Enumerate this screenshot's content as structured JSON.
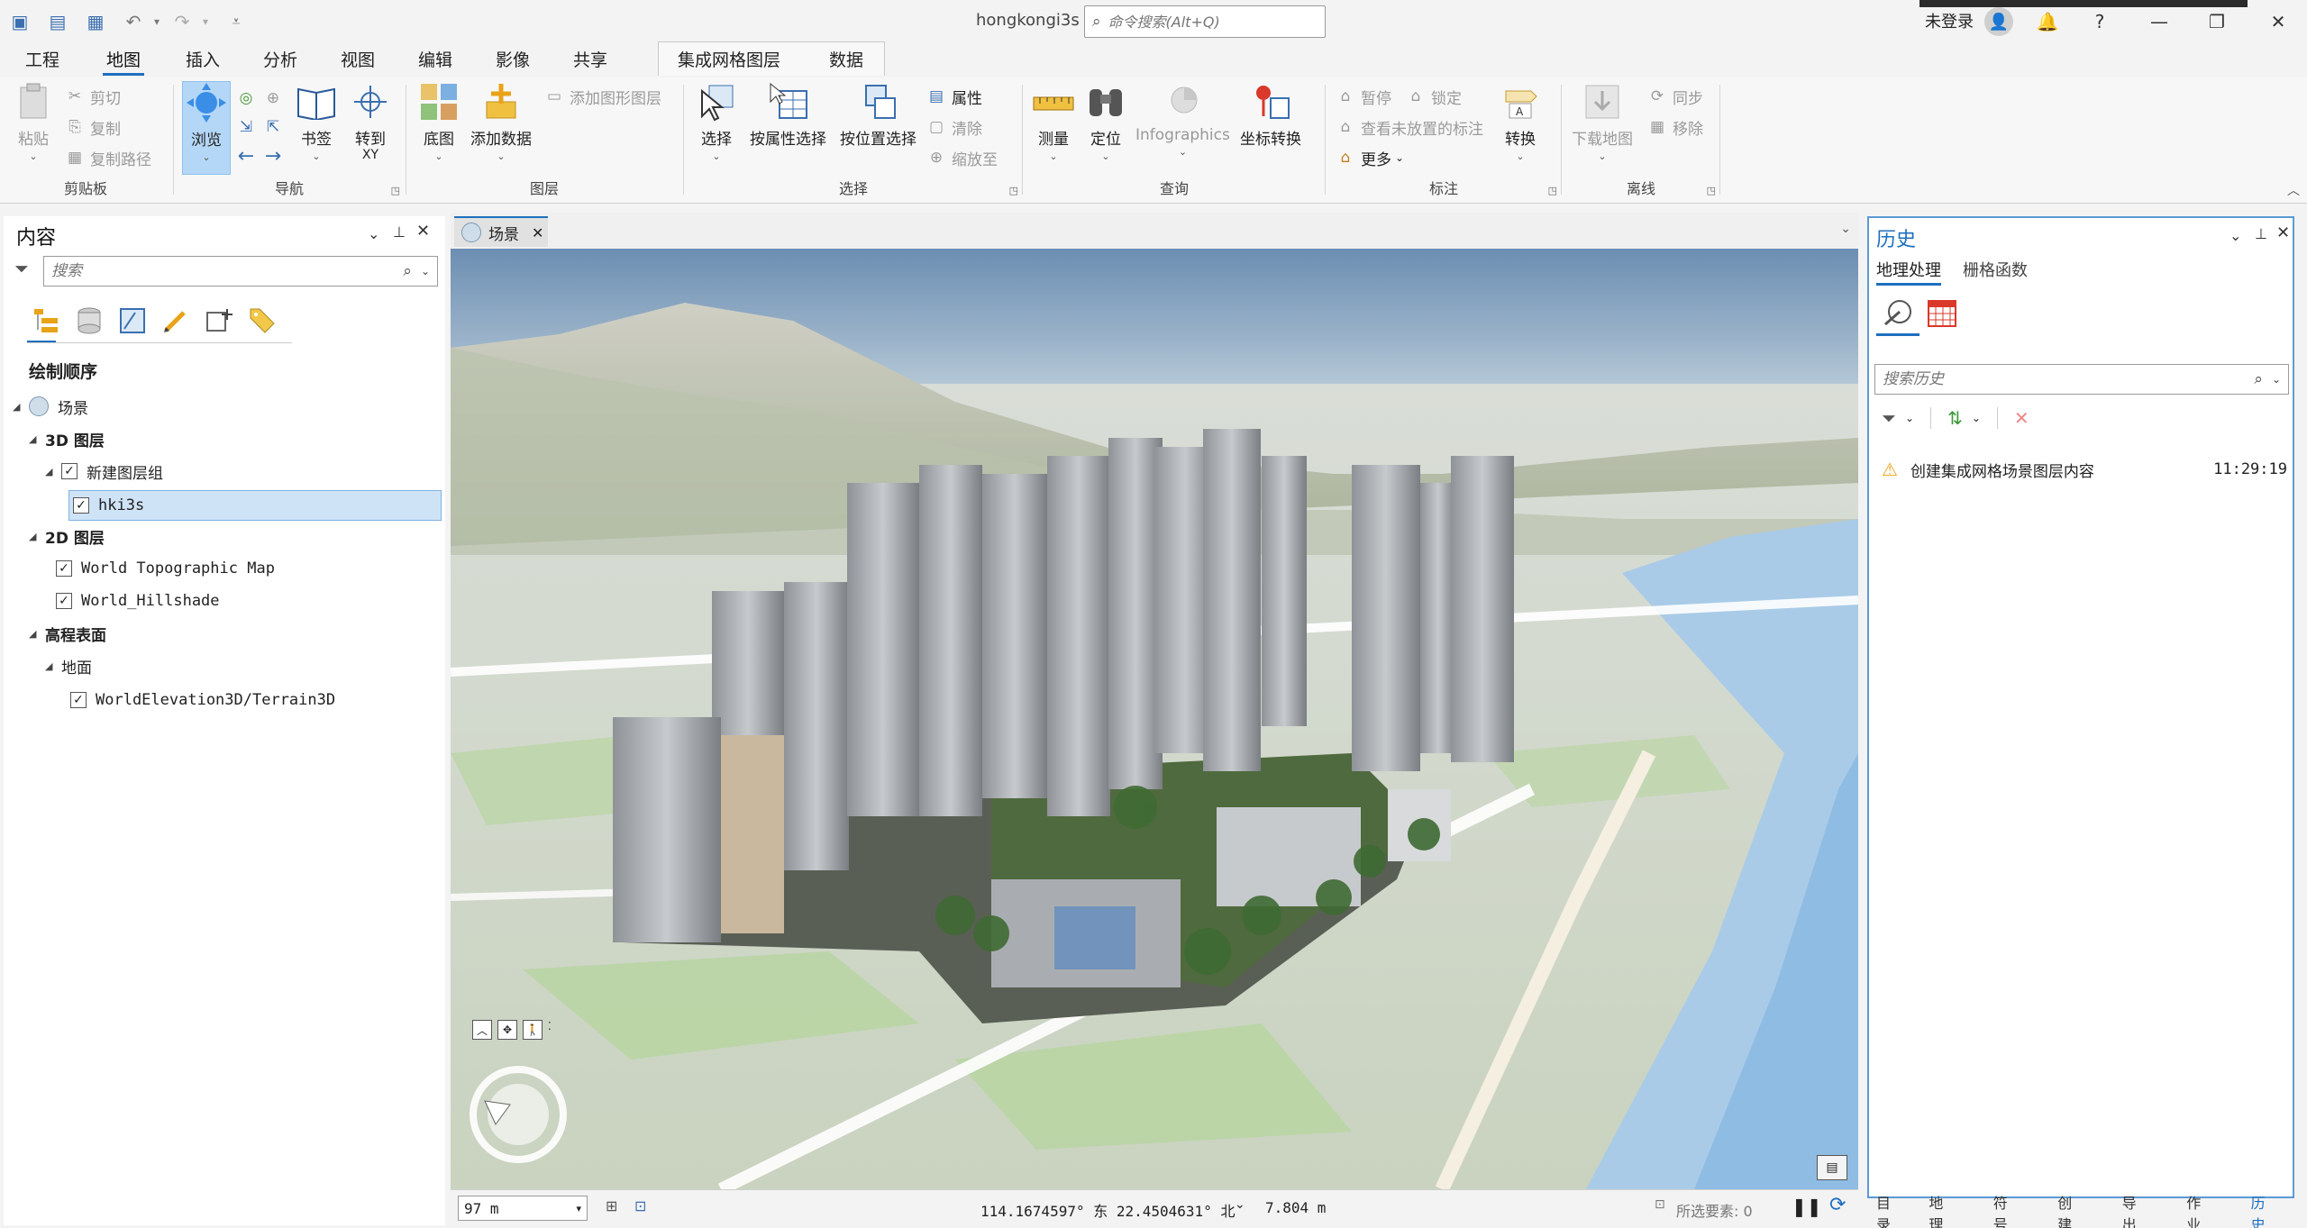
{
  "app": {
    "title": "hongkongi3s",
    "command_search_placeholder": "命令搜索(Alt+Q)",
    "sign_in": "未登录",
    "help": "?"
  },
  "ribbon_tabs": [
    "工程",
    "地图",
    "插入",
    "分析",
    "视图",
    "编辑",
    "影像",
    "共享"
  ],
  "context_tabs": [
    "集成网格图层",
    "数据"
  ],
  "ribbon": {
    "clipboard": {
      "label": "剪贴板",
      "paste": "粘贴",
      "cut": "剪切",
      "copy": "复制",
      "copy_path": "复制路径"
    },
    "navigate": {
      "label": "导航",
      "explore": "浏览",
      "bookmarks": "书签",
      "goto_xy": "转到",
      "goto_xy2": "XY"
    },
    "layer": {
      "label": "图层",
      "basemap": "底图",
      "add_data": "添加数据",
      "add_graphics": "添加图形图层"
    },
    "selection": {
      "label": "选择",
      "select": "选择",
      "by_attr": "按属性选择",
      "by_loc": "按位置选择",
      "attributes": "属性",
      "clear": "清除",
      "zoom_to": "缩放至"
    },
    "inquiry": {
      "label": "查询",
      "measure": "测量",
      "locate": "定位",
      "infographics": "Infographics",
      "coord_convert": "坐标转换"
    },
    "labeling": {
      "label": "标注",
      "pause": "暂停",
      "lock": "锁定",
      "view_unplaced": "查看未放置的标注",
      "more": "更多",
      "convert": "转换"
    },
    "offline": {
      "label": "离线",
      "download_map": "下载地图",
      "sync": "同步",
      "remove": "移除"
    }
  },
  "contents": {
    "title": "内容",
    "search_placeholder": "搜索",
    "section": "绘制顺序",
    "scene": "场景",
    "layers3d": "3D 图层",
    "group": "新建图层组",
    "layer_hki3s": "hki3s",
    "layers2d": "2D 图层",
    "topo": "World Topographic Map",
    "hillshade": "World_Hillshade",
    "elevation": "高程表面",
    "ground": "地面",
    "terrain": "WorldElevation3D/Terrain3D"
  },
  "map": {
    "tab_label": "场景",
    "scale": "97 m",
    "coords": "114.1674597° 东 22.4504631° 北",
    "elevation": "7.804 m",
    "selected_features": "所选要素: 0"
  },
  "history": {
    "title": "历史",
    "tab_gp": "地理处理",
    "tab_raster": "栅格函数",
    "search_placeholder": "搜索历史",
    "entries": [
      {
        "text": "创建集成网格场景图层内容",
        "time": "11:29:19"
      }
    ]
  },
  "bottom_tabs": [
    "目录",
    "地理…",
    "符号…",
    "创建…",
    "导出…",
    "作业…",
    "历史"
  ],
  "colors": {
    "accent": "#1f6fbf",
    "selection_bg": "#cfe3f7",
    "warning": "#e8a317"
  }
}
